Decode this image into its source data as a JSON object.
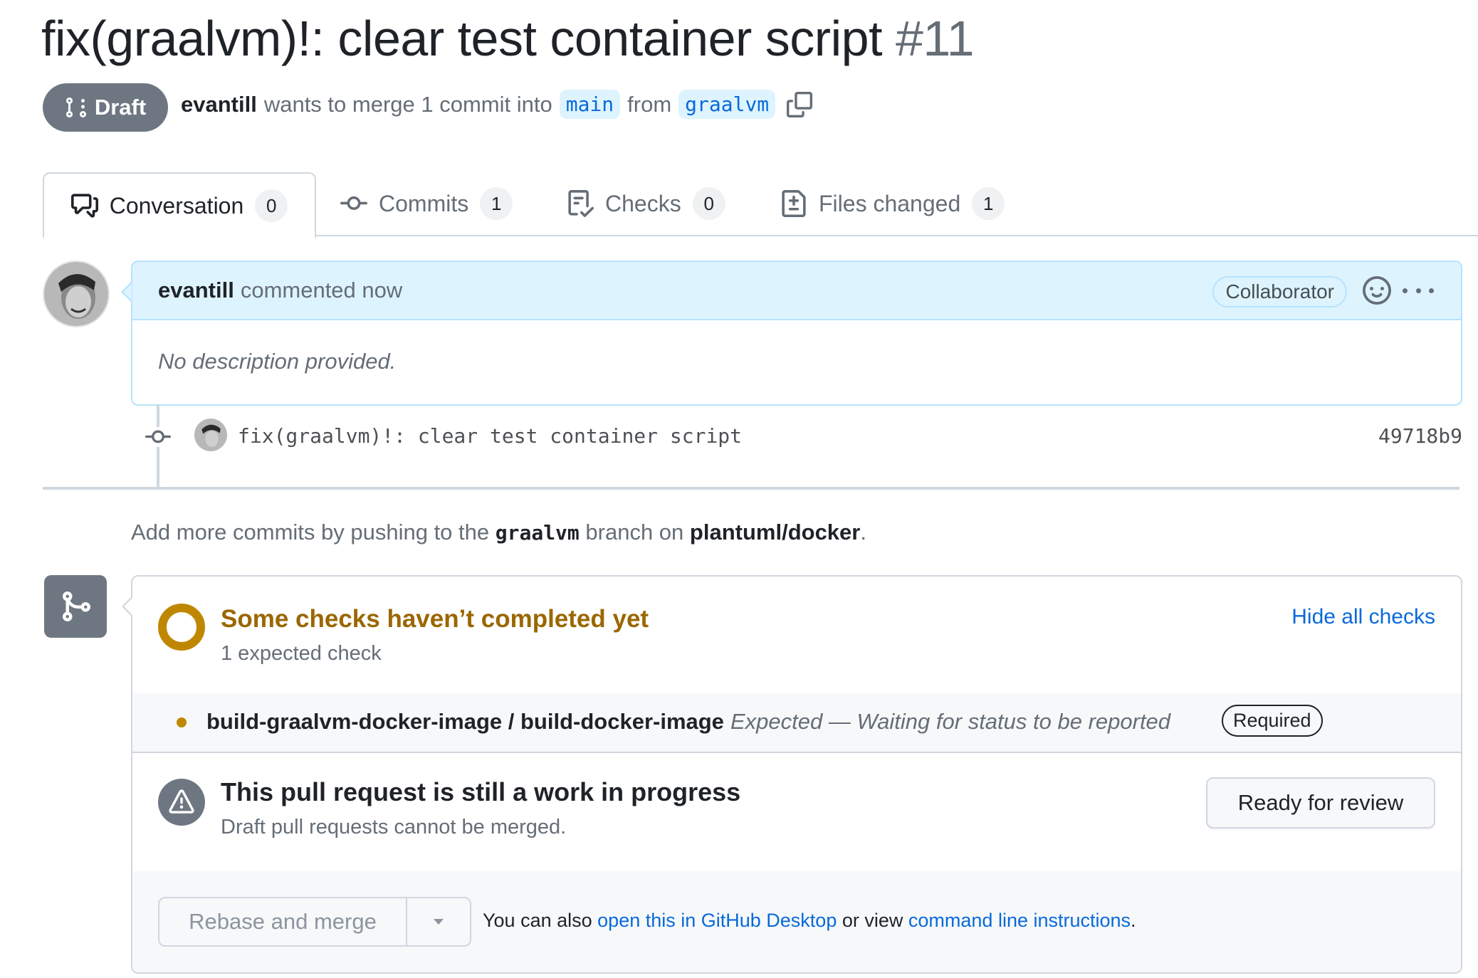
{
  "pr": {
    "title": "fix(graalvm)!: clear test container script",
    "number": "#11",
    "state_label": "Draft",
    "author": "evantill",
    "merge_text_1": "wants to merge 1 commit into",
    "base_branch": "main",
    "merge_text_2": "from",
    "head_branch": "graalvm"
  },
  "tabs": [
    {
      "label": "Conversation",
      "count": "0",
      "icon": "comment-discussion-icon",
      "active": true
    },
    {
      "label": "Commits",
      "count": "1",
      "icon": "git-commit-icon"
    },
    {
      "label": "Checks",
      "count": "0",
      "icon": "checklist-icon"
    },
    {
      "label": "Files changed",
      "count": "1",
      "icon": "file-diff-icon"
    }
  ],
  "comment": {
    "author": "evantill",
    "action": "commented now",
    "role_badge": "Collaborator",
    "body": "No description provided."
  },
  "commit": {
    "message": "fix(graalvm)!: clear test container script",
    "sha": "49718b9"
  },
  "push_hint": {
    "prefix": "Add more commits by pushing to the",
    "branch": "graalvm",
    "middle": "branch on",
    "repo": "plantuml/docker",
    "suffix": "."
  },
  "checks": {
    "title": "Some checks haven’t completed yet",
    "subtitle": "1 expected check",
    "toggle_label": "Hide all checks",
    "status_color": "#bf8700",
    "items": [
      {
        "name": "build-graalvm-docker-image / build-docker-image",
        "status": "Expected — Waiting for status to be reported",
        "badge": "Required"
      }
    ]
  },
  "wip": {
    "title": "This pull request is still a work in progress",
    "subtitle": "Draft pull requests cannot be merged.",
    "ready_button": "Ready for review"
  },
  "merge": {
    "button_label": "Rebase and merge",
    "hint_prefix": "You can also",
    "desktop_link": "open this in GitHub Desktop",
    "hint_middle": "or view",
    "cli_link": "command line instructions",
    "hint_suffix": "."
  }
}
